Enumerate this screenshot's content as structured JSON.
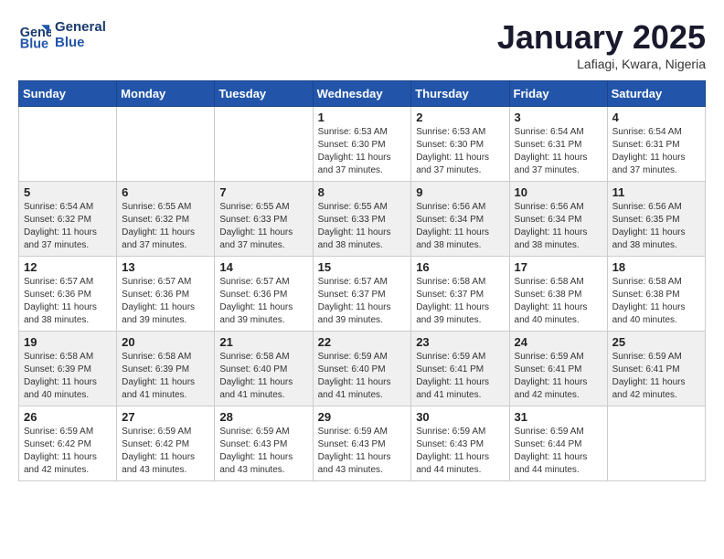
{
  "header": {
    "logo_line1": "General",
    "logo_line2": "Blue",
    "month": "January 2025",
    "location": "Lafiagi, Kwara, Nigeria"
  },
  "weekdays": [
    "Sunday",
    "Monday",
    "Tuesday",
    "Wednesday",
    "Thursday",
    "Friday",
    "Saturday"
  ],
  "weeks": [
    [
      {
        "num": "",
        "info": ""
      },
      {
        "num": "",
        "info": ""
      },
      {
        "num": "",
        "info": ""
      },
      {
        "num": "1",
        "info": "Sunrise: 6:53 AM\nSunset: 6:30 PM\nDaylight: 11 hours\nand 37 minutes."
      },
      {
        "num": "2",
        "info": "Sunrise: 6:53 AM\nSunset: 6:30 PM\nDaylight: 11 hours\nand 37 minutes."
      },
      {
        "num": "3",
        "info": "Sunrise: 6:54 AM\nSunset: 6:31 PM\nDaylight: 11 hours\nand 37 minutes."
      },
      {
        "num": "4",
        "info": "Sunrise: 6:54 AM\nSunset: 6:31 PM\nDaylight: 11 hours\nand 37 minutes."
      }
    ],
    [
      {
        "num": "5",
        "info": "Sunrise: 6:54 AM\nSunset: 6:32 PM\nDaylight: 11 hours\nand 37 minutes."
      },
      {
        "num": "6",
        "info": "Sunrise: 6:55 AM\nSunset: 6:32 PM\nDaylight: 11 hours\nand 37 minutes."
      },
      {
        "num": "7",
        "info": "Sunrise: 6:55 AM\nSunset: 6:33 PM\nDaylight: 11 hours\nand 37 minutes."
      },
      {
        "num": "8",
        "info": "Sunrise: 6:55 AM\nSunset: 6:33 PM\nDaylight: 11 hours\nand 38 minutes."
      },
      {
        "num": "9",
        "info": "Sunrise: 6:56 AM\nSunset: 6:34 PM\nDaylight: 11 hours\nand 38 minutes."
      },
      {
        "num": "10",
        "info": "Sunrise: 6:56 AM\nSunset: 6:34 PM\nDaylight: 11 hours\nand 38 minutes."
      },
      {
        "num": "11",
        "info": "Sunrise: 6:56 AM\nSunset: 6:35 PM\nDaylight: 11 hours\nand 38 minutes."
      }
    ],
    [
      {
        "num": "12",
        "info": "Sunrise: 6:57 AM\nSunset: 6:36 PM\nDaylight: 11 hours\nand 38 minutes."
      },
      {
        "num": "13",
        "info": "Sunrise: 6:57 AM\nSunset: 6:36 PM\nDaylight: 11 hours\nand 39 minutes."
      },
      {
        "num": "14",
        "info": "Sunrise: 6:57 AM\nSunset: 6:36 PM\nDaylight: 11 hours\nand 39 minutes."
      },
      {
        "num": "15",
        "info": "Sunrise: 6:57 AM\nSunset: 6:37 PM\nDaylight: 11 hours\nand 39 minutes."
      },
      {
        "num": "16",
        "info": "Sunrise: 6:58 AM\nSunset: 6:37 PM\nDaylight: 11 hours\nand 39 minutes."
      },
      {
        "num": "17",
        "info": "Sunrise: 6:58 AM\nSunset: 6:38 PM\nDaylight: 11 hours\nand 40 minutes."
      },
      {
        "num": "18",
        "info": "Sunrise: 6:58 AM\nSunset: 6:38 PM\nDaylight: 11 hours\nand 40 minutes."
      }
    ],
    [
      {
        "num": "19",
        "info": "Sunrise: 6:58 AM\nSunset: 6:39 PM\nDaylight: 11 hours\nand 40 minutes."
      },
      {
        "num": "20",
        "info": "Sunrise: 6:58 AM\nSunset: 6:39 PM\nDaylight: 11 hours\nand 41 minutes."
      },
      {
        "num": "21",
        "info": "Sunrise: 6:58 AM\nSunset: 6:40 PM\nDaylight: 11 hours\nand 41 minutes."
      },
      {
        "num": "22",
        "info": "Sunrise: 6:59 AM\nSunset: 6:40 PM\nDaylight: 11 hours\nand 41 minutes."
      },
      {
        "num": "23",
        "info": "Sunrise: 6:59 AM\nSunset: 6:41 PM\nDaylight: 11 hours\nand 41 minutes."
      },
      {
        "num": "24",
        "info": "Sunrise: 6:59 AM\nSunset: 6:41 PM\nDaylight: 11 hours\nand 42 minutes."
      },
      {
        "num": "25",
        "info": "Sunrise: 6:59 AM\nSunset: 6:41 PM\nDaylight: 11 hours\nand 42 minutes."
      }
    ],
    [
      {
        "num": "26",
        "info": "Sunrise: 6:59 AM\nSunset: 6:42 PM\nDaylight: 11 hours\nand 42 minutes."
      },
      {
        "num": "27",
        "info": "Sunrise: 6:59 AM\nSunset: 6:42 PM\nDaylight: 11 hours\nand 43 minutes."
      },
      {
        "num": "28",
        "info": "Sunrise: 6:59 AM\nSunset: 6:43 PM\nDaylight: 11 hours\nand 43 minutes."
      },
      {
        "num": "29",
        "info": "Sunrise: 6:59 AM\nSunset: 6:43 PM\nDaylight: 11 hours\nand 43 minutes."
      },
      {
        "num": "30",
        "info": "Sunrise: 6:59 AM\nSunset: 6:43 PM\nDaylight: 11 hours\nand 44 minutes."
      },
      {
        "num": "31",
        "info": "Sunrise: 6:59 AM\nSunset: 6:44 PM\nDaylight: 11 hours\nand 44 minutes."
      },
      {
        "num": "",
        "info": ""
      }
    ]
  ]
}
